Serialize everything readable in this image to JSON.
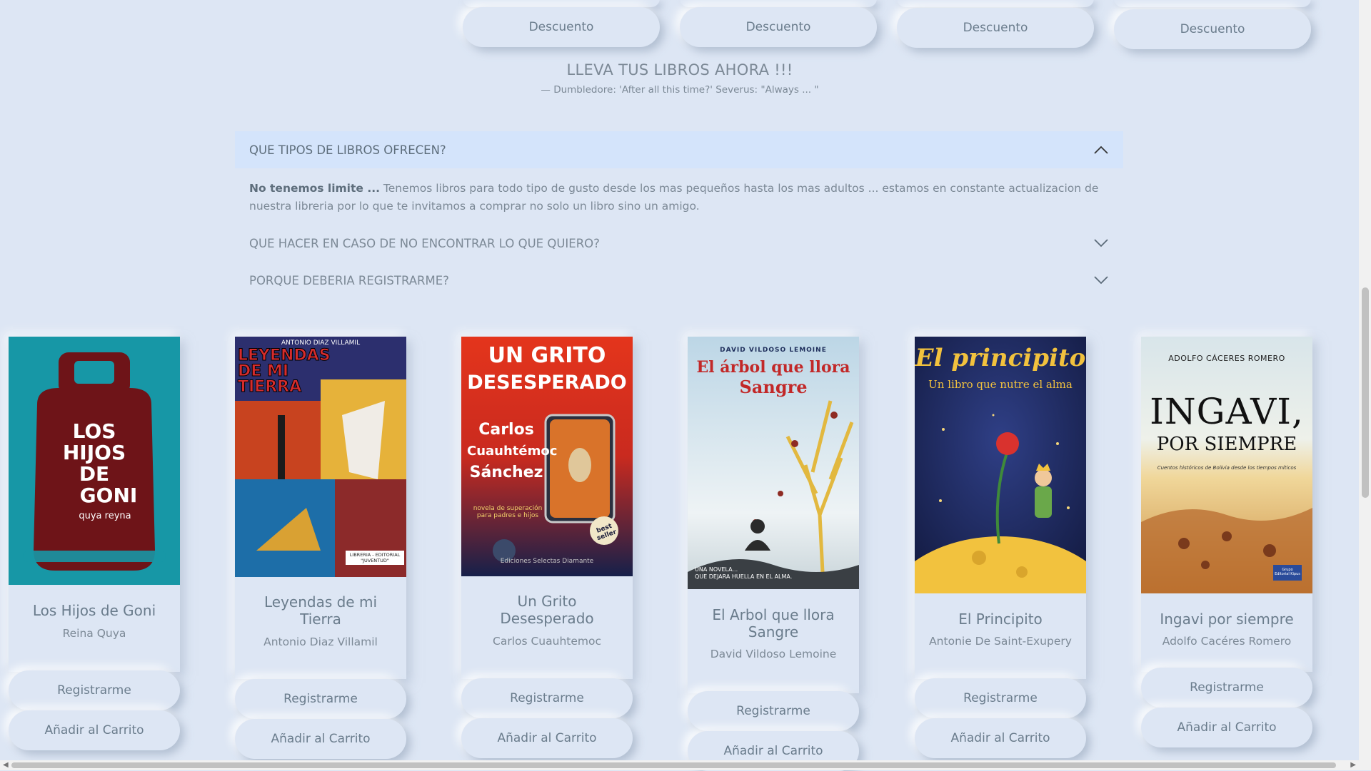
{
  "top_buttons": [
    "Descuento",
    "Descuento",
    "Descuento",
    "Descuento"
  ],
  "tagline": "LLEVA TUS LIBROS AHORA !!!",
  "quote": "— Dumbledore: 'After all this time?' Severus: \"Always ... \"",
  "faq": {
    "open_question": "QUE TIPOS DE LIBROS OFRECEN?",
    "answer_bold": "No tenemos limite ...",
    "answer_text": " Tenemos libros para todo tipo de gusto desde los mas pequeños hasta los mas adultos ... estamos en constante actualizacion de nuestra libreria por lo que te invitamos a comprar no solo un libro sino un amigo.",
    "question_2": "QUE HACER EN CASO DE NO ENCONTRAR LO QUE QUIERO?",
    "question_3": "PORQUE DEBERIA REGISTRARME?"
  },
  "books": [
    {
      "title": "Los Hijos de Goni",
      "author": "Reina Quya",
      "register": "Registrarme",
      "cart": "Añadir al Carrito",
      "cover_lines": [
        "LOS",
        "HIJOS",
        "DE",
        "GONI",
        "quya reyna"
      ]
    },
    {
      "title": "Leyendas de mi Tierra",
      "author": "Antonio Diaz Villamil",
      "register": "Registrarme",
      "cart": "Añadir al Carrito",
      "cover_lines": [
        "ANTONIO DIAZ VILLAMIL",
        "LEYENDAS",
        "DE MI",
        "TIERRA",
        "LIBRERIA - EDITORIAL \"JUVENTUD\""
      ]
    },
    {
      "title": "Un Grito Desesperado",
      "author": "Carlos Cuauhtemoc",
      "register": "Registrarme",
      "cart": "Añadir al Carrito",
      "cover_lines": [
        "UN GRITO",
        "DESESPERADO",
        "Carlos",
        "Cuauhtémoc",
        "Sánchez",
        "novela de superación para padres e hijos",
        "best seller",
        "Ediciones Selectas Diamante"
      ]
    },
    {
      "title": "El Arbol que llora Sangre",
      "author": "David Vildoso Lemoine",
      "register": "Registrarme",
      "cart": "Añadir al Carrito",
      "cover_lines": [
        "DAVID VILDOSO LEMOINE",
        "El árbol que llora",
        "Sangre",
        "UNA NOVELA...",
        "QUE DEJARA HUELLA EN EL ALMA."
      ]
    },
    {
      "title": "El Principito",
      "author": "Antonie De Saint-Exupery",
      "register": "Registrarme",
      "cart": "Añadir al Carrito",
      "cover_lines": [
        "El principito",
        "Un libro que nutre el alma"
      ]
    },
    {
      "title": "Ingavi por siempre",
      "author": "Adolfo Cacéres Romero",
      "register": "Registrarme",
      "cart": "Añadir al Carrito",
      "cover_lines": [
        "ADOLFO CÁCERES ROMERO",
        "INGAVI,",
        "POR SIEMPRE",
        "Cuentos históricos de Bolivia desde los tiempos míticos",
        "Grupo Editorial Kipus"
      ]
    }
  ]
}
